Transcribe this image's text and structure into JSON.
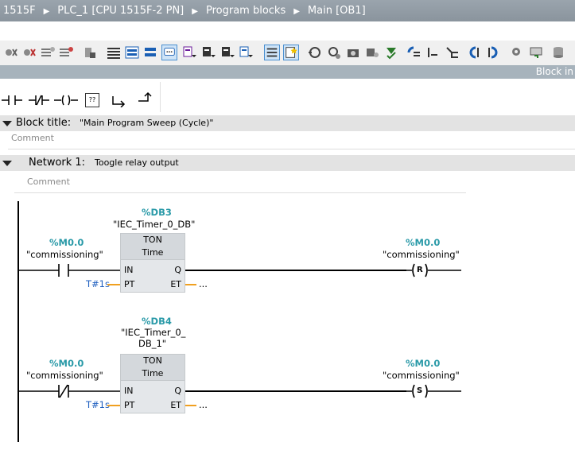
{
  "breadcrumb": [
    "1515F",
    "PLC_1 [CPU 1515F-2 PN]",
    "Program blocks",
    "Main [OB1]"
  ],
  "infobar": {
    "label": "Block in"
  },
  "favorites": [
    {
      "name": "normally-open-contact",
      "symbol": "-| |-"
    },
    {
      "name": "normally-closed-contact",
      "symbol": "-|/|-"
    },
    {
      "name": "output-coil",
      "symbol": "-( )-"
    },
    {
      "name": "empty-box",
      "symbol": "??"
    },
    {
      "name": "open-branch",
      "symbol": "↦"
    },
    {
      "name": "close-branch",
      "symbol": "↱"
    }
  ],
  "block": {
    "title_label": "Block title:",
    "title_value": "\"Main Program Sweep (Cycle)\"",
    "comment": "Comment"
  },
  "network": {
    "label": "Network 1:",
    "title": "Toogle relay output",
    "comment": "Comment"
  },
  "rungs": [
    {
      "contact_addr": "%M0.0",
      "contact_name": "\"commissioning\"",
      "contact_type": "normally-open",
      "db_addr": "%DB3",
      "db_name": "\"IEC_Timer_0_DB\"",
      "db_name_line2": "",
      "fb_type": "TON",
      "fb_sub": "Time",
      "pin_in": "IN",
      "pin_pt": "PT",
      "pin_q": "Q",
      "pin_et": "ET",
      "pt_value": "T#1s",
      "et_value": "...",
      "coil_addr": "%M0.0",
      "coil_name": "\"commissioning\"",
      "coil_type": "R"
    },
    {
      "contact_addr": "%M0.0",
      "contact_name": "\"commissioning\"",
      "contact_type": "normally-closed",
      "db_addr": "%DB4",
      "db_name": "\"IEC_Timer_0_",
      "db_name_line2": "DB_1\"",
      "fb_type": "TON",
      "fb_sub": "Time",
      "pin_in": "IN",
      "pin_pt": "PT",
      "pin_q": "Q",
      "pin_et": "ET",
      "pt_value": "T#1s",
      "et_value": "...",
      "coil_addr": "%M0.0",
      "coil_name": "\"commissioning\"",
      "coil_type": "S"
    }
  ],
  "colors": {
    "address": "#2a9aa8",
    "constant": "#2060c0",
    "wire_orange": "#f0a020",
    "header_bg": "#e3e3e3"
  }
}
